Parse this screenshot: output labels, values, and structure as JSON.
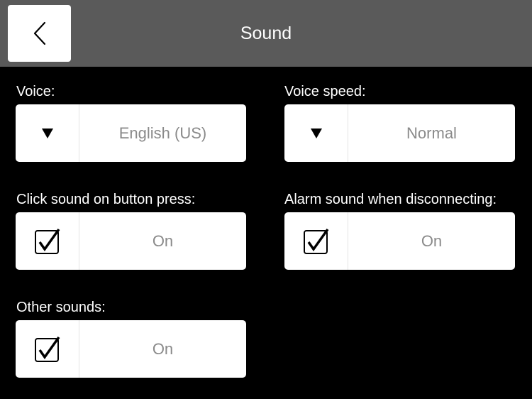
{
  "header": {
    "title": "Sound",
    "back_icon": "chevron-left-icon"
  },
  "voice": {
    "label": "Voice:",
    "value": "English (US)",
    "icon": "dropdown-triangle-icon"
  },
  "voice_speed": {
    "label": "Voice speed:",
    "value": "Normal",
    "icon": "dropdown-triangle-icon"
  },
  "click_sound": {
    "label": "Click sound on button press:",
    "value": "On",
    "checked": true
  },
  "alarm_sound": {
    "label": "Alarm sound when disconnecting:",
    "value": "On",
    "checked": true
  },
  "other_sounds": {
    "label": "Other sounds:",
    "value": "On",
    "checked": true
  },
  "colors": {
    "header_bg": "#5a5a5a",
    "page_bg": "#000000",
    "control_bg": "#ffffff",
    "value_text": "#8a8a8a"
  }
}
